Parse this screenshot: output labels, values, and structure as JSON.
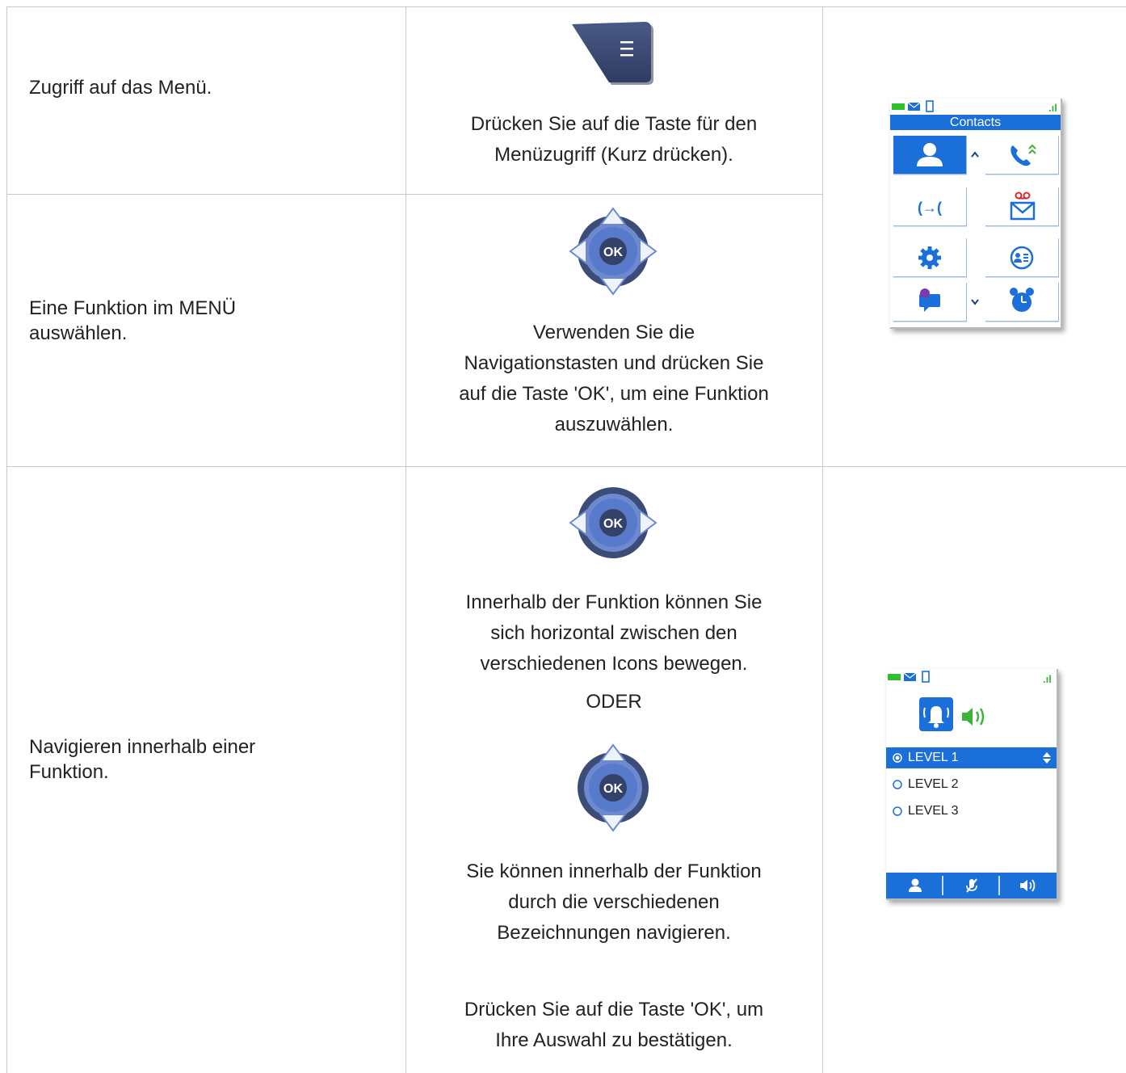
{
  "rows": [
    {
      "description": "Zugriff auf das Menü.",
      "instruction": "Drücken Sie auf die Taste für den Menüzugriff (Kurz drücken)."
    },
    {
      "description": "Eine Funktion im MENÜ auswählen.",
      "instruction_lines": [
        "Verwenden Sie die",
        "Navigationstasten und drücken Sie",
        "auf die Taste 'OK', um eine Funktion",
        "auszuwählen."
      ]
    },
    {
      "description": "Navigieren innerhalb einer Funktion.",
      "instruction_a_lines": [
        "Innerhalb der Funktion können Sie",
        "sich horizontal zwischen den",
        "verschiedenen Icons bewegen."
      ],
      "or_label": "ODER",
      "instruction_b_lines": [
        "Sie können innerhalb der Funktion",
        "durch die verschiedenen",
        "Bezeichnungen navigieren."
      ],
      "confirm_lines": [
        "Drücken Sie auf die Taste 'OK', um",
        "Ihre Auswahl zu bestätigen."
      ]
    }
  ],
  "keys": {
    "ok_label": "OK"
  },
  "phone_menu": {
    "title": "Contacts",
    "tiles": [
      "contacts-icon",
      "call-log-icon",
      "transfer-icon",
      "voicemail-icon",
      "settings-icon",
      "vcard-icon",
      "chat-icon",
      "alarm-icon"
    ]
  },
  "phone_level": {
    "items": [
      "LEVEL 1",
      "LEVEL 2",
      "LEVEL 3"
    ],
    "selected_index": 0,
    "bottom_icons": [
      "user-icon",
      "mute-icon",
      "speaker-icon"
    ]
  },
  "colors": {
    "accent": "#1a6fd8",
    "key_dark": "#3a4a72",
    "signal": "#3cb43c",
    "battery": "#2ec02e",
    "voicemail_red": "#d62b2b"
  }
}
